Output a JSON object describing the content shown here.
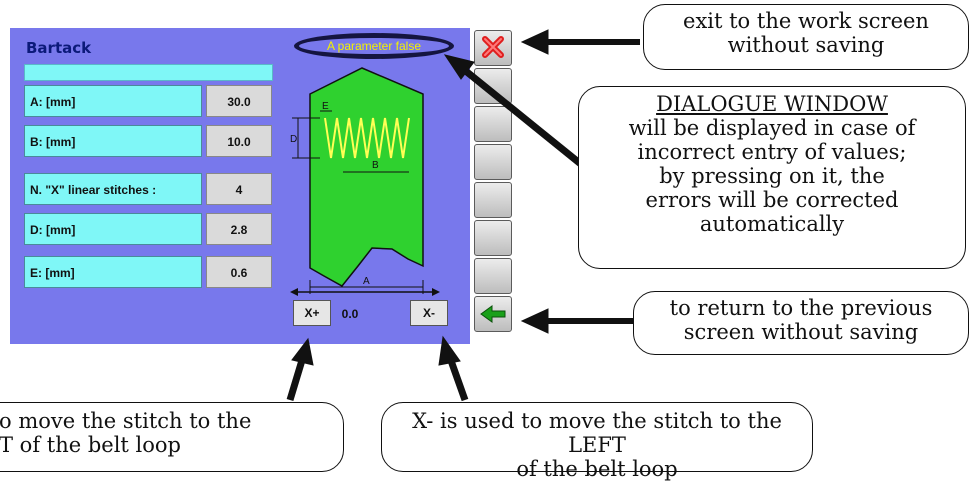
{
  "screen": {
    "title": "Bartack",
    "name_field": "",
    "dialog_text": "A parameter false",
    "params": [
      {
        "label": "A: [mm]",
        "value": "30.0"
      },
      {
        "label": "B: [mm]",
        "value": "10.0"
      },
      {
        "label": "N. \"X\" linear stitches :",
        "value": "4"
      },
      {
        "label": "D: [mm]",
        "value": "2.8"
      },
      {
        "label": "E: [mm]",
        "value": "0.6"
      }
    ],
    "diagram": {
      "label_a": "A",
      "label_b": "B",
      "label_d": "D",
      "label_e": "E"
    },
    "x_plus": "X+",
    "x_minus": "X-",
    "offset": "0.0"
  },
  "colors": {
    "screen_bg": "#7878ec",
    "field": "#7ff7f7",
    "shape": "#2fd12f",
    "stitch": "#ffff55"
  },
  "callouts": {
    "exit": [
      "exit to the work screen",
      "without saving"
    ],
    "dialogue_title": "DIALOGUE WINDOW",
    "dialogue_body": [
      "will be displayed in case of",
      "incorrect entry of values;",
      "by pressing on it, the",
      "errors will be corrected",
      "automatically"
    ],
    "return": [
      "to return to the previous",
      "screen without saving"
    ],
    "x_minus": [
      "X- is used to move the stitch to the LEFT",
      "of the belt loop"
    ],
    "x_plus": [
      "o move the stitch to the",
      "T of the belt loop"
    ]
  },
  "icons": {
    "exit": "close-x-icon",
    "back": "green-arrow-left-icon"
  }
}
